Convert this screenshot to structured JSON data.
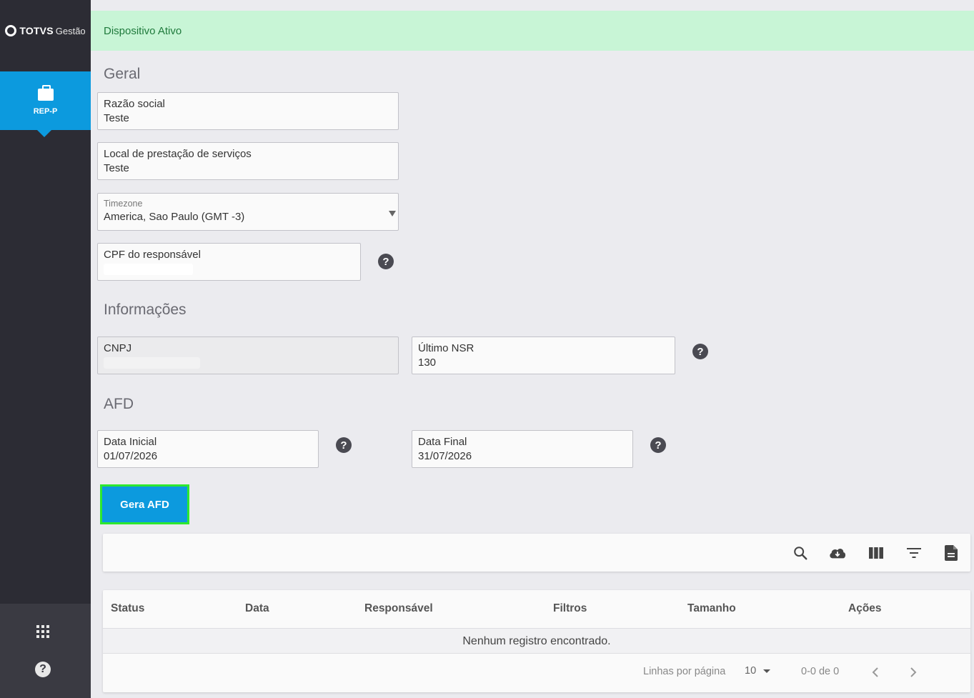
{
  "app": {
    "logo_brand": "TOTVS",
    "logo_sub": "Gestão",
    "nav_items": [
      {
        "label": "REP-P",
        "icon": "briefcase-icon"
      }
    ]
  },
  "status": {
    "text": "Dispositivo Ativo",
    "color": "#1f7a3c",
    "background": "#c8f5d6"
  },
  "geral": {
    "title": "Geral",
    "razao_social": {
      "label": "Razão social",
      "value": "Teste"
    },
    "local_servicos": {
      "label": "Local de prestação de serviços",
      "value": "Teste"
    },
    "timezone": {
      "label": "Timezone",
      "value": "America, Sao Paulo (GMT -3)"
    },
    "cpf": {
      "label": "CPF do responsável",
      "value": ""
    }
  },
  "informacoes": {
    "title": "Informações",
    "cnpj": {
      "label": "CNPJ",
      "value": ""
    },
    "ultimo_nsr": {
      "label": "Último NSR",
      "value": "130"
    }
  },
  "afd": {
    "title": "AFD",
    "data_inicial": {
      "label": "Data Inicial",
      "value": "01/07/2026"
    },
    "data_final": {
      "label": "Data Final",
      "value": "31/07/2026"
    },
    "button_label": "Gera AFD"
  },
  "table": {
    "columns": [
      "Status",
      "Data",
      "Responsável",
      "Filtros",
      "Tamanho",
      "Ações"
    ],
    "empty_text": "Nenhum registro encontrado.",
    "rows_per_page_label": "Linhas por página",
    "rows_per_page_value": "10",
    "range_text": "0-0 de 0"
  },
  "colors": {
    "accent": "#0c9ade",
    "sidebar": "#2c2c34",
    "highlight_border": "#2ee82e"
  }
}
